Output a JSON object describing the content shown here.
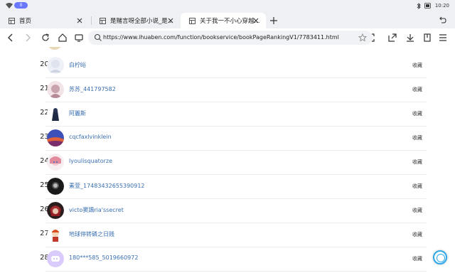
{
  "status_bar": {
    "pill_text": "0",
    "time": "10:20"
  },
  "tabs": [
    {
      "title": "首页",
      "active": false
    },
    {
      "title": "是赌言呀全部小说_是...",
      "active": false
    },
    {
      "title": "关于我一不小心穿越...",
      "active": true
    }
  ],
  "toolbar": {
    "url": "https://www.ihuaben.com/function/bookservice/bookPageRankingV1/7783411.html"
  },
  "ranking": {
    "favorite_label": "收藏",
    "rows": [
      {
        "rank": "20.",
        "name": "白柠峪",
        "avatar": "white-hair-avatar"
      },
      {
        "rank": "21.",
        "name": "苏苏_441797582",
        "avatar": "pink-hair-avatar"
      },
      {
        "rank": "22.",
        "name": "阿麗斯",
        "avatar": "dark-figure-avatar"
      },
      {
        "rank": "23.",
        "name": "cqcfaxlvinklein",
        "avatar": "sunset-avatar"
      },
      {
        "rank": "24.",
        "name": "lyoulisquatorze",
        "avatar": "anime-girl-avatar"
      },
      {
        "rank": "25.",
        "name": "素萱_17483432655390912",
        "avatar": "dark-avatar"
      },
      {
        "rank": "26.",
        "name": "victo窦踽ria'ssecret",
        "avatar": "red-hair-avatar"
      },
      {
        "rank": "27.",
        "name": "地球停转磷之日贱",
        "avatar": "cartoon-kid-avatar"
      },
      {
        "rank": "28.",
        "name": "180***585_5019660972",
        "avatar": "default-purple-avatar"
      }
    ]
  }
}
